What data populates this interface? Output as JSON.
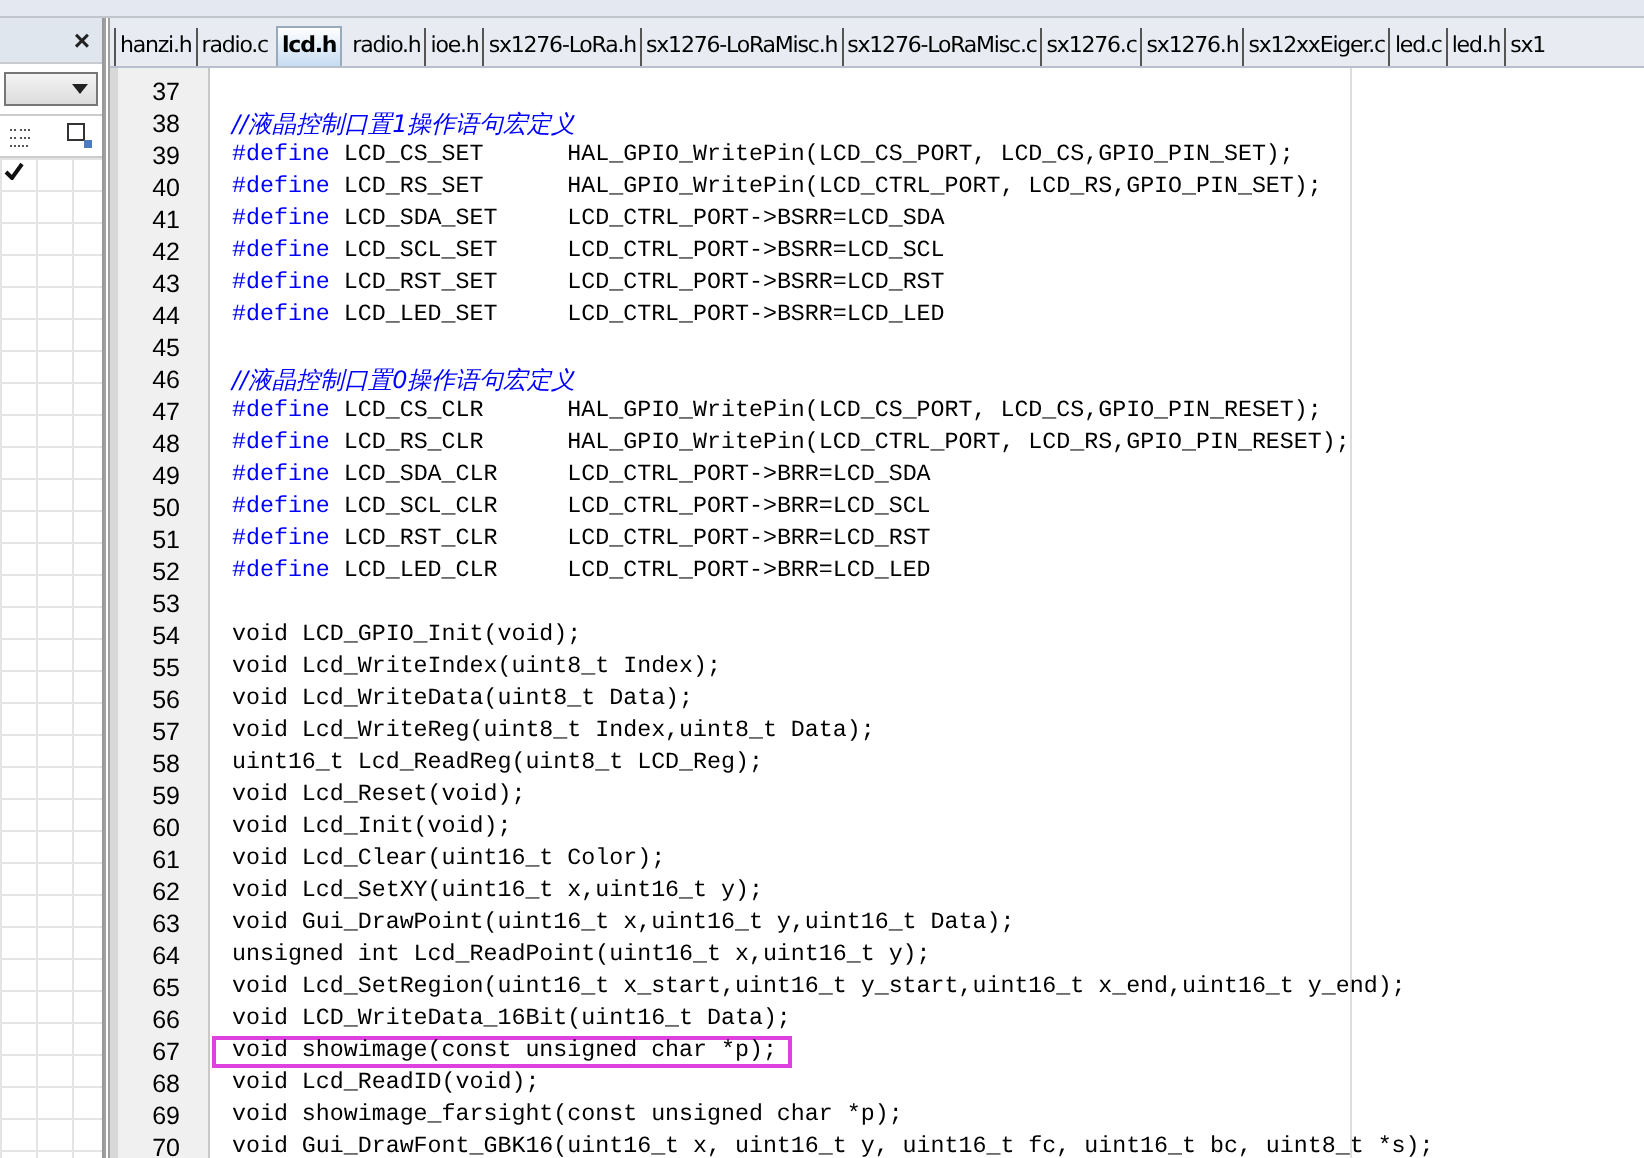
{
  "sidebar": {
    "close": "×",
    "toolbar_checked": true
  },
  "tabs": [
    {
      "label": "hanzi.h",
      "selected": false
    },
    {
      "label": "radio.c",
      "selected": false
    },
    {
      "label": "lcd.h",
      "selected": true
    },
    {
      "label": "radio.h",
      "selected": false
    },
    {
      "label": "ioe.h",
      "selected": false
    },
    {
      "label": "sx1276-LoRa.h",
      "selected": false
    },
    {
      "label": "sx1276-LoRaMisc.h",
      "selected": false
    },
    {
      "label": "sx1276-LoRaMisc.c",
      "selected": false
    },
    {
      "label": "sx1276.c",
      "selected": false
    },
    {
      "label": "sx1276.h",
      "selected": false
    },
    {
      "label": "sx12xxEiger.c",
      "selected": false
    },
    {
      "label": "led.c",
      "selected": false
    },
    {
      "label": "led.h",
      "selected": false
    },
    {
      "label": "sx1",
      "selected": false
    }
  ],
  "editor": {
    "lines": [
      {
        "number": "37",
        "kind": "blank",
        "highlighted": false
      },
      {
        "number": "38",
        "kind": "comment",
        "text": "//液晶控制口置1操作语句宏定义",
        "highlighted": false
      },
      {
        "number": "39",
        "kind": "define",
        "keyword": "#define",
        "text": " LCD_CS_SET      HAL_GPIO_WritePin(LCD_CS_PORT, LCD_CS,GPIO_PIN_SET);",
        "highlighted": false
      },
      {
        "number": "40",
        "kind": "define",
        "keyword": "#define",
        "text": " LCD_RS_SET      HAL_GPIO_WritePin(LCD_CTRL_PORT, LCD_RS,GPIO_PIN_SET);",
        "highlighted": false
      },
      {
        "number": "41",
        "kind": "define",
        "keyword": "#define",
        "text": " LCD_SDA_SET     LCD_CTRL_PORT->BSRR=LCD_SDA",
        "highlighted": false
      },
      {
        "number": "42",
        "kind": "define",
        "keyword": "#define",
        "text": " LCD_SCL_SET     LCD_CTRL_PORT->BSRR=LCD_SCL",
        "highlighted": false
      },
      {
        "number": "43",
        "kind": "define",
        "keyword": "#define",
        "text": " LCD_RST_SET     LCD_CTRL_PORT->BSRR=LCD_RST",
        "highlighted": false
      },
      {
        "number": "44",
        "kind": "define",
        "keyword": "#define",
        "text": " LCD_LED_SET     LCD_CTRL_PORT->BSRR=LCD_LED",
        "highlighted": false
      },
      {
        "number": "45",
        "kind": "blank",
        "highlighted": false
      },
      {
        "number": "46",
        "kind": "comment",
        "text": "//液晶控制口置0操作语句宏定义",
        "highlighted": false
      },
      {
        "number": "47",
        "kind": "define",
        "keyword": "#define",
        "text": " LCD_CS_CLR      HAL_GPIO_WritePin(LCD_CS_PORT, LCD_CS,GPIO_PIN_RESET);",
        "highlighted": false
      },
      {
        "number": "48",
        "kind": "define",
        "keyword": "#define",
        "text": " LCD_RS_CLR      HAL_GPIO_WritePin(LCD_CTRL_PORT, LCD_RS,GPIO_PIN_RESET);",
        "highlighted": false
      },
      {
        "number": "49",
        "kind": "define",
        "keyword": "#define",
        "text": " LCD_SDA_CLR     LCD_CTRL_PORT->BRR=LCD_SDA",
        "highlighted": false
      },
      {
        "number": "50",
        "kind": "define",
        "keyword": "#define",
        "text": " LCD_SCL_CLR     LCD_CTRL_PORT->BRR=LCD_SCL",
        "highlighted": false
      },
      {
        "number": "51",
        "kind": "define",
        "keyword": "#define",
        "text": " LCD_RST_CLR     LCD_CTRL_PORT->BRR=LCD_RST",
        "highlighted": false
      },
      {
        "number": "52",
        "kind": "define",
        "keyword": "#define",
        "text": " LCD_LED_CLR     LCD_CTRL_PORT->BRR=LCD_LED",
        "highlighted": false
      },
      {
        "number": "53",
        "kind": "blank",
        "highlighted": false
      },
      {
        "number": "54",
        "kind": "code",
        "text": "void LCD_GPIO_Init(void);",
        "highlighted": false
      },
      {
        "number": "55",
        "kind": "code",
        "text": "void Lcd_WriteIndex(uint8_t Index);",
        "highlighted": false
      },
      {
        "number": "56",
        "kind": "code",
        "text": "void Lcd_WriteData(uint8_t Data);",
        "highlighted": false
      },
      {
        "number": "57",
        "kind": "code",
        "text": "void Lcd_WriteReg(uint8_t Index,uint8_t Data);",
        "highlighted": false
      },
      {
        "number": "58",
        "kind": "code",
        "text": "uint16_t Lcd_ReadReg(uint8_t LCD_Reg);",
        "highlighted": false
      },
      {
        "number": "59",
        "kind": "code",
        "text": "void Lcd_Reset(void);",
        "highlighted": false
      },
      {
        "number": "60",
        "kind": "code",
        "text": "void Lcd_Init(void);",
        "highlighted": false
      },
      {
        "number": "61",
        "kind": "code",
        "text": "void Lcd_Clear(uint16_t Color);",
        "highlighted": false
      },
      {
        "number": "62",
        "kind": "code",
        "text": "void Lcd_SetXY(uint16_t x,uint16_t y);",
        "highlighted": false
      },
      {
        "number": "63",
        "kind": "code",
        "text": "void Gui_DrawPoint(uint16_t x,uint16_t y,uint16_t Data);",
        "highlighted": false
      },
      {
        "number": "64",
        "kind": "code",
        "text": "unsigned int Lcd_ReadPoint(uint16_t x,uint16_t y);",
        "highlighted": false
      },
      {
        "number": "65",
        "kind": "code",
        "text": "void Lcd_SetRegion(uint16_t x_start,uint16_t y_start,uint16_t x_end,uint16_t y_end);",
        "highlighted": false
      },
      {
        "number": "66",
        "kind": "code",
        "text": "void LCD_WriteData_16Bit(uint16_t Data);",
        "highlighted": false
      },
      {
        "number": "67",
        "kind": "code",
        "text": "void showimage(const unsigned char *p);",
        "highlighted": true
      },
      {
        "number": "68",
        "kind": "code",
        "text": "void Lcd_ReadID(void);",
        "highlighted": false
      },
      {
        "number": "69",
        "kind": "code",
        "text": "void showimage_farsight(const unsigned char *p);",
        "highlighted": false
      },
      {
        "number": "70",
        "kind": "code",
        "text": "void Gui_DrawFont_GBK16(uint16_t x, uint16_t y, uint16_t fc, uint16_t bc, uint8_t *s);",
        "highlighted": false
      }
    ]
  }
}
